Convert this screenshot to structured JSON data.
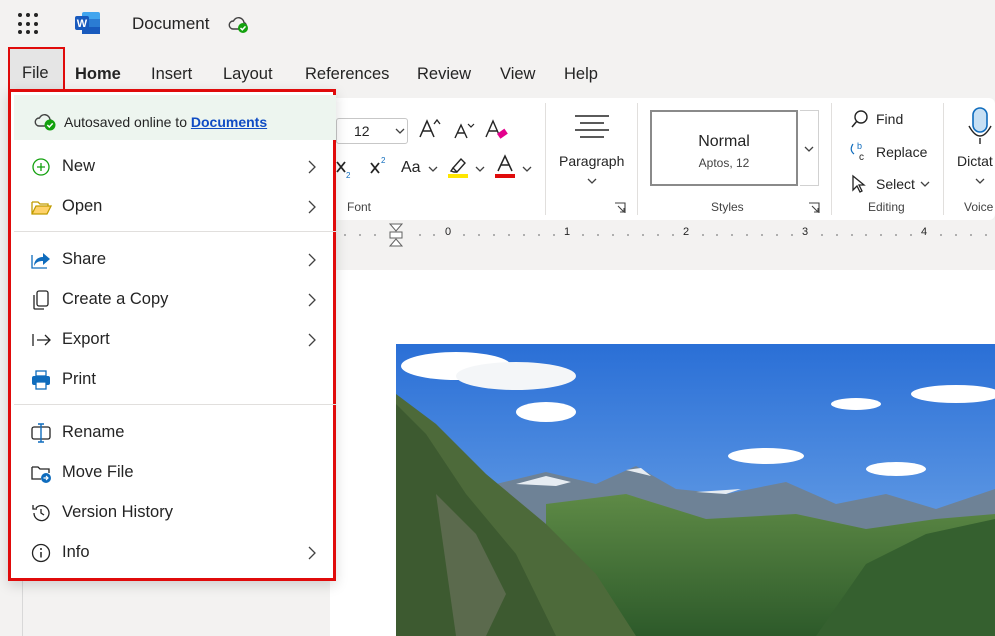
{
  "app": {
    "name": "Word",
    "document_title": "Document",
    "cloud_status": "saved"
  },
  "tabs": [
    {
      "label": "File",
      "active_menu": true
    },
    {
      "label": "Home",
      "selected": true
    },
    {
      "label": "Insert"
    },
    {
      "label": "Layout"
    },
    {
      "label": "References"
    },
    {
      "label": "Review"
    },
    {
      "label": "View"
    },
    {
      "label": "Help"
    }
  ],
  "ribbon": {
    "font_size": "12",
    "font_group_label": "Font",
    "case_label": "Aa",
    "paragraph_label": "Paragraph",
    "styles": {
      "current_name": "Normal",
      "current_desc": "Aptos, 12",
      "group_label": "Styles"
    },
    "editing": {
      "find": "Find",
      "replace": "Replace",
      "select": "Select",
      "group_label": "Editing"
    },
    "voice": {
      "dictate": "Dictat",
      "group_label": "Voice"
    }
  },
  "ruler": {
    "numbers": [
      "0",
      "1",
      "2",
      "3",
      "4"
    ]
  },
  "file_menu": {
    "autosave_text": "Autosaved online to",
    "autosave_link": "Documents",
    "sections": [
      [
        {
          "label": "New",
          "icon": "plus-circle-icon",
          "has_submenu": true
        },
        {
          "label": "Open",
          "icon": "folder-open-icon",
          "has_submenu": true
        }
      ],
      [
        {
          "label": "Share",
          "icon": "share-icon",
          "has_submenu": true
        },
        {
          "label": "Create a Copy",
          "icon": "copy-icon",
          "has_submenu": true
        },
        {
          "label": "Export",
          "icon": "export-icon",
          "has_submenu": true
        },
        {
          "label": "Print",
          "icon": "printer-icon",
          "has_submenu": false
        }
      ],
      [
        {
          "label": "Rename",
          "icon": "rename-icon",
          "has_submenu": false
        },
        {
          "label": "Move File",
          "icon": "move-file-icon",
          "has_submenu": false
        },
        {
          "label": "Version History",
          "icon": "history-icon",
          "has_submenu": false
        },
        {
          "label": "Info",
          "icon": "info-icon",
          "has_submenu": true
        }
      ]
    ]
  },
  "colors": {
    "highlight_box": "#e00b0b",
    "link": "#0f4cc4",
    "autosave_bg": "#edf5ef",
    "word_blue": "#185abd",
    "highlighter_yellow": "#ffe600",
    "font_color_red": "#e00b0b"
  }
}
